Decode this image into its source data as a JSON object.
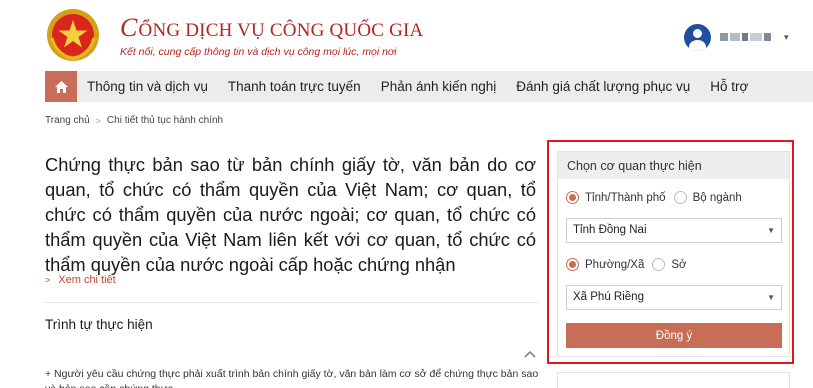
{
  "header": {
    "title_initial": "C",
    "title_rest": "ỔNG DỊCH VỤ CÔNG QUỐC GIA",
    "subtitle": "Kết nối, cung cấp thông tin và dịch vụ công mọi lúc, mọi nơi",
    "emblem_icon": "national-emblem-icon",
    "avatar_icon": "user-avatar-icon"
  },
  "nav": {
    "home_icon": "home-icon",
    "items": [
      "Thông tin và dịch vụ",
      "Thanh toán trực tuyến",
      "Phản ánh kiến nghị",
      "Đánh giá chất lượng phục vụ",
      "Hỗ trợ"
    ]
  },
  "breadcrumb": {
    "home": "Trang chủ",
    "current": "Chi tiết thủ tục hành chính"
  },
  "procedure": {
    "title": "Chứng thực bản sao từ bản chính giấy tờ, văn bản do cơ quan, tổ chức có thẩm quyền của Việt Nam; cơ quan, tổ chức có thẩm quyền của nước ngoài; cơ quan, tổ chức có thẩm quyền của Việt Nam liên kết với cơ quan, tổ chức có thẩm quyền của nước ngoài cấp hoặc chứng nhận",
    "detail_link": "Xem chi tiết",
    "section_title": "Trình tự thực hiện",
    "step_text": "+ Người yêu cầu chứng thực phải xuất trình bản chính giấy tờ, văn bản làm cơ sở để chứng thực bản sao và bản sao cần chứng thực."
  },
  "agency_panel": {
    "heading": "Chọn cơ quan thực hiện",
    "level1_options": [
      "Tỉnh/Thành phố",
      "Bộ ngành"
    ],
    "level1_selected": "Tỉnh/Thành phố",
    "province_value": "Tỉnh Đồng Nai",
    "level2_options": [
      "Phường/Xã",
      "Sở"
    ],
    "level2_selected": "Phường/Xã",
    "ward_value": "Xã Phú Riềng",
    "submit_label": "Đồng ý"
  },
  "colors": {
    "brand_red": "#b3261e",
    "accent": "#c86e57",
    "highlight_outline": "#e01a1a",
    "nav_bg": "#ececec"
  }
}
